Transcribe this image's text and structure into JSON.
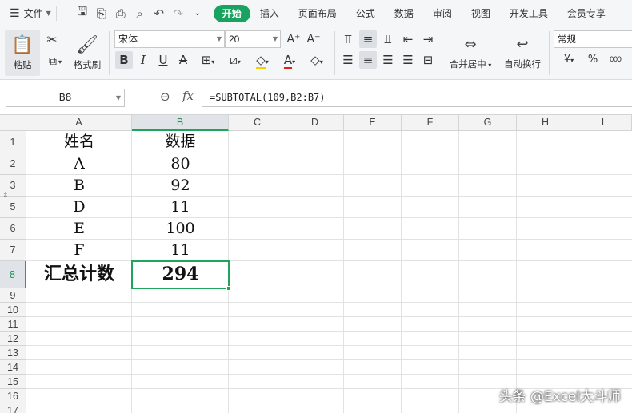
{
  "menu": {
    "file_label": "文件",
    "tabs": [
      "开始",
      "插入",
      "页面布局",
      "公式",
      "数据",
      "审阅",
      "视图",
      "开发工具",
      "会员专享"
    ],
    "active_tab": "开始"
  },
  "ribbon": {
    "paste_label": "粘贴",
    "format_painter_label": "格式刷",
    "font_name": "宋体",
    "font_size": "20",
    "merge_label": "合并居中",
    "wrap_label": "自动换行",
    "number_format": "常规",
    "currency_symbol": "¥",
    "percent_symbol": "%",
    "thousands_symbol": "000"
  },
  "formula_bar": {
    "name_box": "B8",
    "fx_label": "fx",
    "formula": "=SUBTOTAL(109,B2:B7)"
  },
  "sheet": {
    "columns": [
      "A",
      "B",
      "C",
      "D",
      "E",
      "F",
      "G",
      "H",
      "I"
    ],
    "rows": [
      "1",
      "2",
      "3",
      "5",
      "6",
      "7",
      "8",
      "9",
      "10",
      "11",
      "12",
      "13",
      "14",
      "15",
      "16",
      "17"
    ],
    "selected_cell": "B8",
    "cells": {
      "A1": "姓名",
      "B1": "数据",
      "A2": "A",
      "B2": "80",
      "A3": "B",
      "B3": "92",
      "A5": "D",
      "B5": "11",
      "A6": "E",
      "B6": "100",
      "A7": "F",
      "B7": "11",
      "A8": "汇总计数",
      "B8": "294"
    }
  },
  "watermark": "头条 @Excel大斗师",
  "colors": {
    "accent": "#1aa260",
    "selection": "#20a35b"
  }
}
